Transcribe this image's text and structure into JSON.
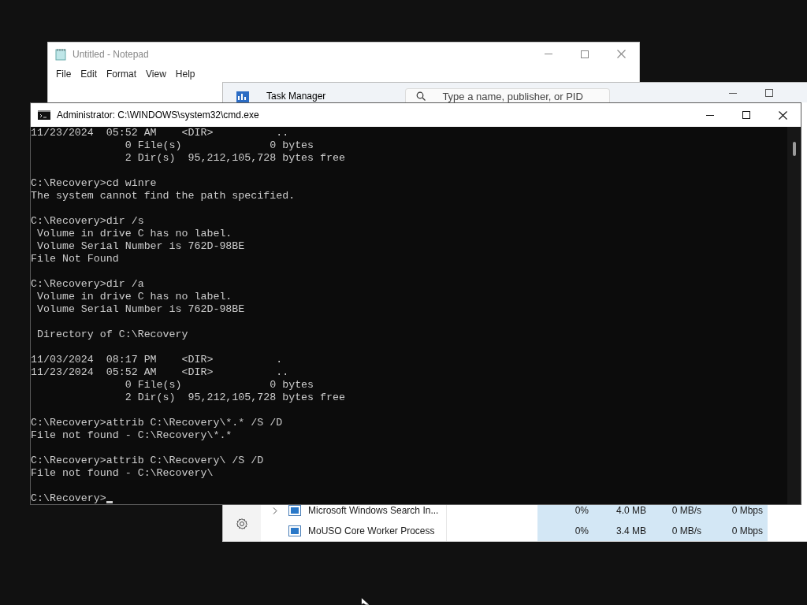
{
  "notepad": {
    "title": "Untitled - Notepad",
    "menu": [
      "File",
      "Edit",
      "Format",
      "View",
      "Help"
    ]
  },
  "task_manager": {
    "title": "Task Manager",
    "search": {
      "placeholder": "Type a name, publisher, or PID"
    },
    "processes": [
      {
        "name": "Microsoft Windows Search In...",
        "expandable": true,
        "cpu": "0%",
        "memory": "4.0 MB",
        "disk": "0 MB/s",
        "network": "0 Mbps"
      },
      {
        "name": "MoUSO Core Worker Process",
        "expandable": false,
        "cpu": "0%",
        "memory": "3.4 MB",
        "disk": "0 MB/s",
        "network": "0 Mbps"
      }
    ]
  },
  "command_prompt": {
    "title": "Administrator: C:\\WINDOWS\\system32\\cmd.exe",
    "blocks": [
      [
        "11/23/2024  05:52 AM    <DIR>          ..",
        "               0 File(s)              0 bytes",
        "               2 Dir(s)  95,212,105,728 bytes free"
      ],
      [
        "C:\\Recovery>cd winre",
        "The system cannot find the path specified."
      ],
      [
        "C:\\Recovery>dir /s",
        " Volume in drive C has no label.",
        " Volume Serial Number is 762D-98BE",
        "File Not Found"
      ],
      [
        "C:\\Recovery>dir /a",
        " Volume in drive C has no label.",
        " Volume Serial Number is 762D-98BE"
      ],
      [
        " Directory of C:\\Recovery"
      ],
      [
        "11/03/2024  08:17 PM    <DIR>          .",
        "11/23/2024  05:52 AM    <DIR>          ..",
        "               0 File(s)              0 bytes",
        "               2 Dir(s)  95,212,105,728 bytes free"
      ],
      [
        "C:\\Recovery>attrib C:\\Recovery\\*.* /S /D",
        "File not found - C:\\Recovery\\*.*"
      ],
      [
        "C:\\Recovery>attrib C:\\Recovery\\ /S /D",
        "File not found - C:\\Recovery\\"
      ]
    ],
    "prompt": "C:\\Recovery>"
  }
}
